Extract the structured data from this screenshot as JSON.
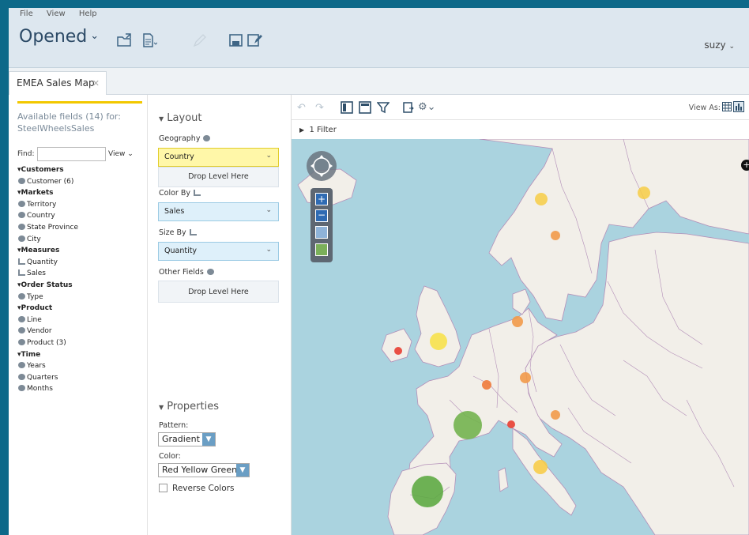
{
  "menu": {
    "file": "File",
    "view": "View",
    "help": "Help"
  },
  "header": {
    "opened_label": "Opened",
    "user": "suzy"
  },
  "tab": {
    "title": "EMEA Sales Map"
  },
  "fields": {
    "available_text": "Available fields (14) for:",
    "source": "SteelWheelsSales",
    "find_label": "Find:",
    "find_value": "",
    "view_label": "View",
    "tree": [
      {
        "label": "Customers",
        "kind": "cat"
      },
      {
        "label": "Customer (6)",
        "kind": "geo"
      },
      {
        "label": "Markets",
        "kind": "cat"
      },
      {
        "label": "Territory",
        "kind": "geo"
      },
      {
        "label": "Country",
        "kind": "geo"
      },
      {
        "label": "State Province",
        "kind": "geo"
      },
      {
        "label": "City",
        "kind": "geo"
      },
      {
        "label": "Measures",
        "kind": "cat"
      },
      {
        "label": "Quantity",
        "kind": "measure"
      },
      {
        "label": "Sales",
        "kind": "measure"
      },
      {
        "label": "Order Status",
        "kind": "cat"
      },
      {
        "label": "Type",
        "kind": "geo"
      },
      {
        "label": "Product",
        "kind": "cat"
      },
      {
        "label": "Line",
        "kind": "geo"
      },
      {
        "label": "Vendor",
        "kind": "geo"
      },
      {
        "label": "Product (3)",
        "kind": "geo"
      },
      {
        "label": "Time",
        "kind": "cat"
      },
      {
        "label": "Years",
        "kind": "geo"
      },
      {
        "label": "Quarters",
        "kind": "geo"
      },
      {
        "label": "Months",
        "kind": "geo"
      }
    ]
  },
  "layout": {
    "title": "Layout",
    "geography_label": "Geography",
    "geography_value": "Country",
    "drop_level": "Drop Level Here",
    "color_by_label": "Color By",
    "color_by_value": "Sales",
    "size_by_label": "Size By",
    "size_by_value": "Quantity",
    "other_fields_label": "Other Fields",
    "other_drop": "Drop Level Here"
  },
  "properties": {
    "title": "Properties",
    "pattern_label": "Pattern:",
    "pattern_value": "Gradient",
    "color_label": "Color:",
    "color_value": "Red Yellow Green",
    "reverse_label": "Reverse Colors",
    "reverse_checked": false
  },
  "map": {
    "view_as": "View As:",
    "filter_text": "1 Filter",
    "sea_color": "#aad3df",
    "land_color": "#f2efe9",
    "border_color": "#b38fb8"
  }
}
